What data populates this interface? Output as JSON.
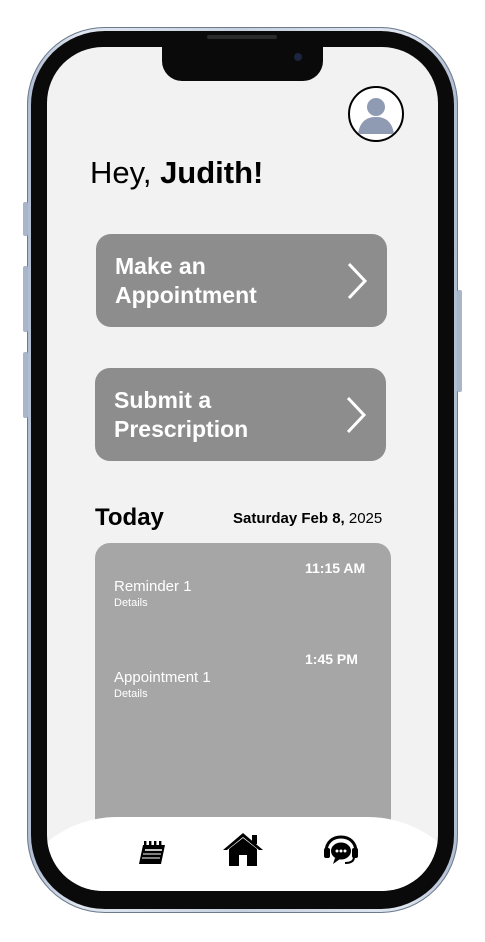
{
  "user": {
    "greeting_prefix": "Hey, ",
    "name": "Judith!"
  },
  "actions": [
    {
      "label": "Make an\nAppointment"
    },
    {
      "label": "Submit a\nPrescription"
    }
  ],
  "today": {
    "title": "Today",
    "date_bold": "Saturday Feb 8,",
    "year": " 2025"
  },
  "events": [
    {
      "time": "11:15 AM",
      "title": "Reminder 1",
      "detail": "Details"
    },
    {
      "time": "1:45 PM",
      "title": "Appointment 1",
      "detail": "Details"
    }
  ],
  "tabbar": {
    "icons": [
      "calendar-icon",
      "home-icon",
      "support-chat-icon"
    ]
  },
  "colors": {
    "screen_bg": "#f2f2f2",
    "action_button": "#8d8d8d",
    "schedule_card": "#a6a6a6",
    "frame": "#c6d0de"
  }
}
